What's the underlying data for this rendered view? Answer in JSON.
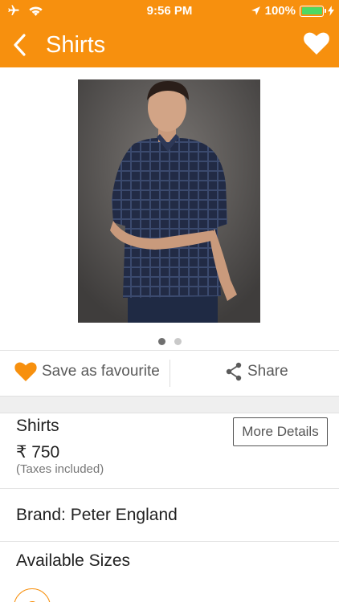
{
  "status_bar": {
    "time": "9:56 PM",
    "battery_percent": "100%",
    "battery_level": 1.0
  },
  "header": {
    "title": "Shirts",
    "back_icon": "chevron-left-icon",
    "favourite_icon": "heart-icon"
  },
  "gallery": {
    "image_count": 2,
    "active_index": 0,
    "image_description_icon": "product-photo"
  },
  "actions": {
    "save_label": "Save as favourite",
    "share_label": "Share"
  },
  "product": {
    "name": "Shirts",
    "price": "₹ 750",
    "tax_note": "(Taxes included)",
    "more_details_label": "More Details",
    "brand": "Brand: Peter England",
    "sizes_title": "Available Sizes",
    "sizes": [
      "S"
    ]
  },
  "colors": {
    "accent": "#f7900e",
    "battery": "#4cd964"
  }
}
